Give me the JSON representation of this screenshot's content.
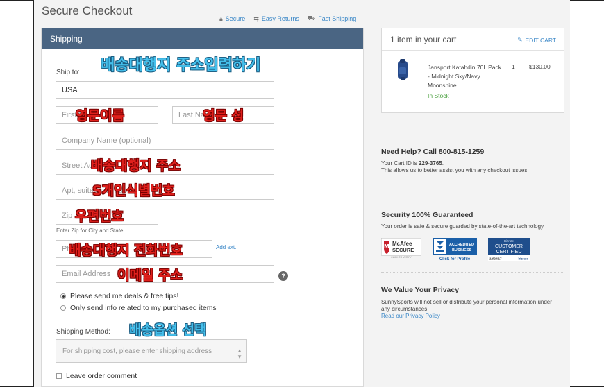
{
  "page": {
    "title": "Secure Checkout",
    "badges": [
      {
        "icon": "lock-icon",
        "label": "Secure"
      },
      {
        "icon": "returns-icon",
        "label": "Easy Returns"
      },
      {
        "icon": "truck-icon",
        "label": "Fast Shipping"
      }
    ]
  },
  "shipping": {
    "header": "Shipping",
    "ship_to_label": "Ship to:",
    "country_value": "USA",
    "first_name_placeholder": "First Name",
    "last_name_placeholder": "Last Name",
    "company_placeholder": "Company Name (optional)",
    "street_placeholder": "Street Address",
    "apt_placeholder": "Apt, suite, unit, etc.",
    "zip_placeholder": "Zip",
    "zip_hint": "Enter Zip for City and State",
    "phone_placeholder": "Phone",
    "add_ext": "Add ext.",
    "email_placeholder": "Email Address",
    "help_symbol": "?",
    "radio_deals": "Please send me deals & free tips!",
    "radio_purchased": "Only send info related to my purchased items",
    "method_label": "Shipping Method:",
    "method_placeholder": "For shipping cost, please enter shipping address",
    "comment_label": "Leave order comment"
  },
  "annotations": {
    "address_input": "배송대행지 주소입력하기",
    "first_name": "영문이름",
    "last_name": "영문 성",
    "street": "배송대행지 주소",
    "apt": "S개인식별번호",
    "zip": "우편번호",
    "phone": "배송대행지 전화번호",
    "email": "이메일 주소",
    "shipping_option": "배송옵션 선택"
  },
  "cart": {
    "title": "1 item in your cart",
    "edit_label": "EDIT CART",
    "item_name": "Jansport Katahdin 70L Pack - Midnight Sky/Navy Moonshine",
    "qty": "1",
    "price": "$130.00",
    "stock": "In Stock"
  },
  "help": {
    "title": "Need Help? Call 800-815-1259",
    "cart_id_label": "Your Cart ID is ",
    "cart_id": "229-3765",
    "cart_id_suffix": ".",
    "text": "This allows us to better assist you with any checkout issues."
  },
  "security": {
    "title": "Security 100% Guaranteed",
    "text": "Your order is safe & secure guarded by state-of-the-art technology.",
    "mcafee_top": "McAfee",
    "mcafee_bottom": "SECURE",
    "mcafee_sub": "CLICK TO VERIFY",
    "bbb_top": "ACCREDITED",
    "bbb_bottom": "BUSINESS",
    "bbb_sub": "Click for Profile",
    "bizrate_top": "Bizrate",
    "bizrate_mid1": "CUSTOMER",
    "bizrate_mid2": "CERTIFIED",
    "bizrate_date": "12/20/17",
    "bizrate_brand": "bizrate"
  },
  "privacy": {
    "title": "We Value Your Privacy",
    "text": "SunnySports will not sell or distribute your personal information under any circumstances.",
    "link": "Read our Privacy Policy"
  },
  "colors": {
    "header_bg": "#4a6583",
    "link": "#3a87c7",
    "in_stock": "#4aa03f",
    "annotation_red": "#e0201c",
    "annotation_blue": "#45c0ec"
  }
}
